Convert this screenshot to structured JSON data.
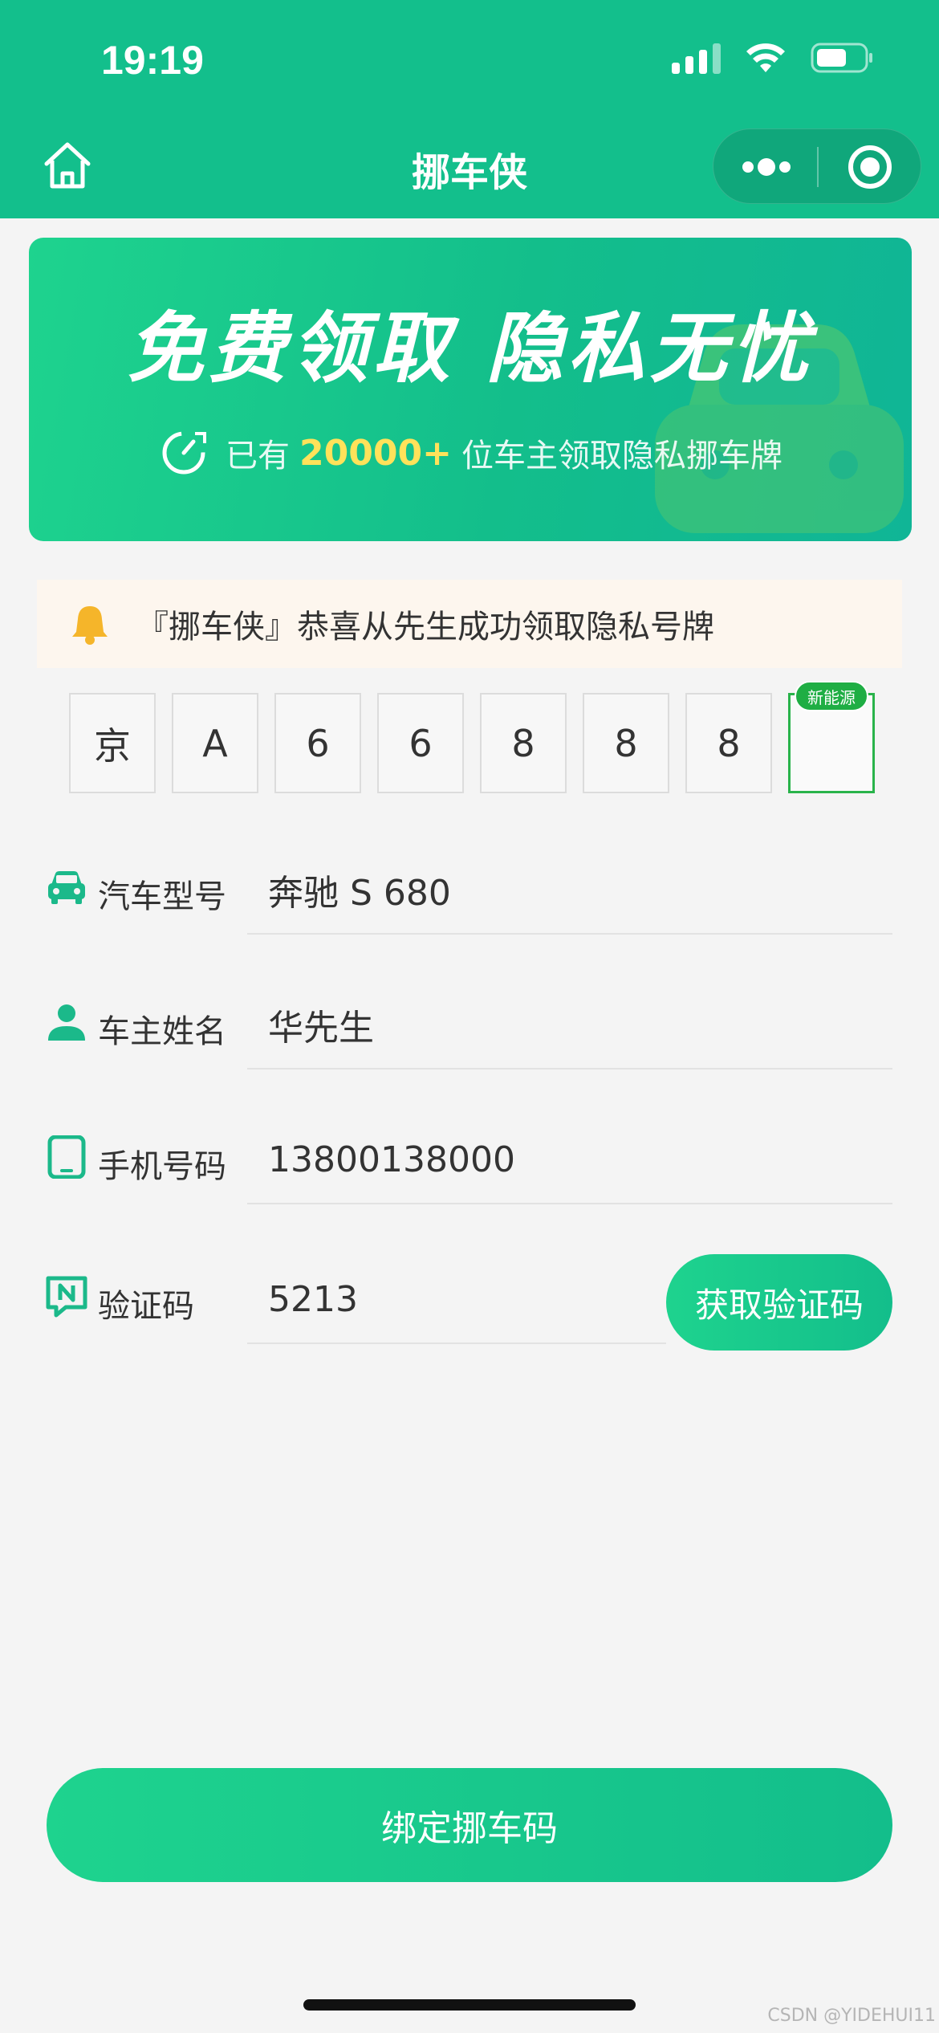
{
  "status_bar": {
    "time": "19:19"
  },
  "nav": {
    "title": "挪车侠"
  },
  "banner": {
    "title": "免费领取  隐私无忧",
    "sub_prefix": "已有",
    "sub_count": "20000+",
    "sub_suffix": "位车主领取隐私挪车牌"
  },
  "notice": {
    "text": "『挪车侠』恭喜从先生成功领取隐私号牌"
  },
  "plate": {
    "chars": [
      "京",
      "A",
      "6",
      "6",
      "8",
      "8",
      "8"
    ],
    "energy_badge": "新能源",
    "energy_value": ""
  },
  "form": {
    "car_model": {
      "label": "汽车型号",
      "value": "奔驰 S 680"
    },
    "owner_name": {
      "label": "车主姓名",
      "value": "华先生"
    },
    "phone": {
      "label": "手机号码",
      "value": "13800138000"
    },
    "code": {
      "label": "验证码",
      "value": "5213",
      "button": "获取验证码"
    }
  },
  "bind_button": "绑定挪车码",
  "watermark": "CSDN @YIDEHUI11",
  "colors": {
    "primary": "#13bf8c",
    "energy": "#29b34a",
    "highlight": "#ffe25a"
  }
}
